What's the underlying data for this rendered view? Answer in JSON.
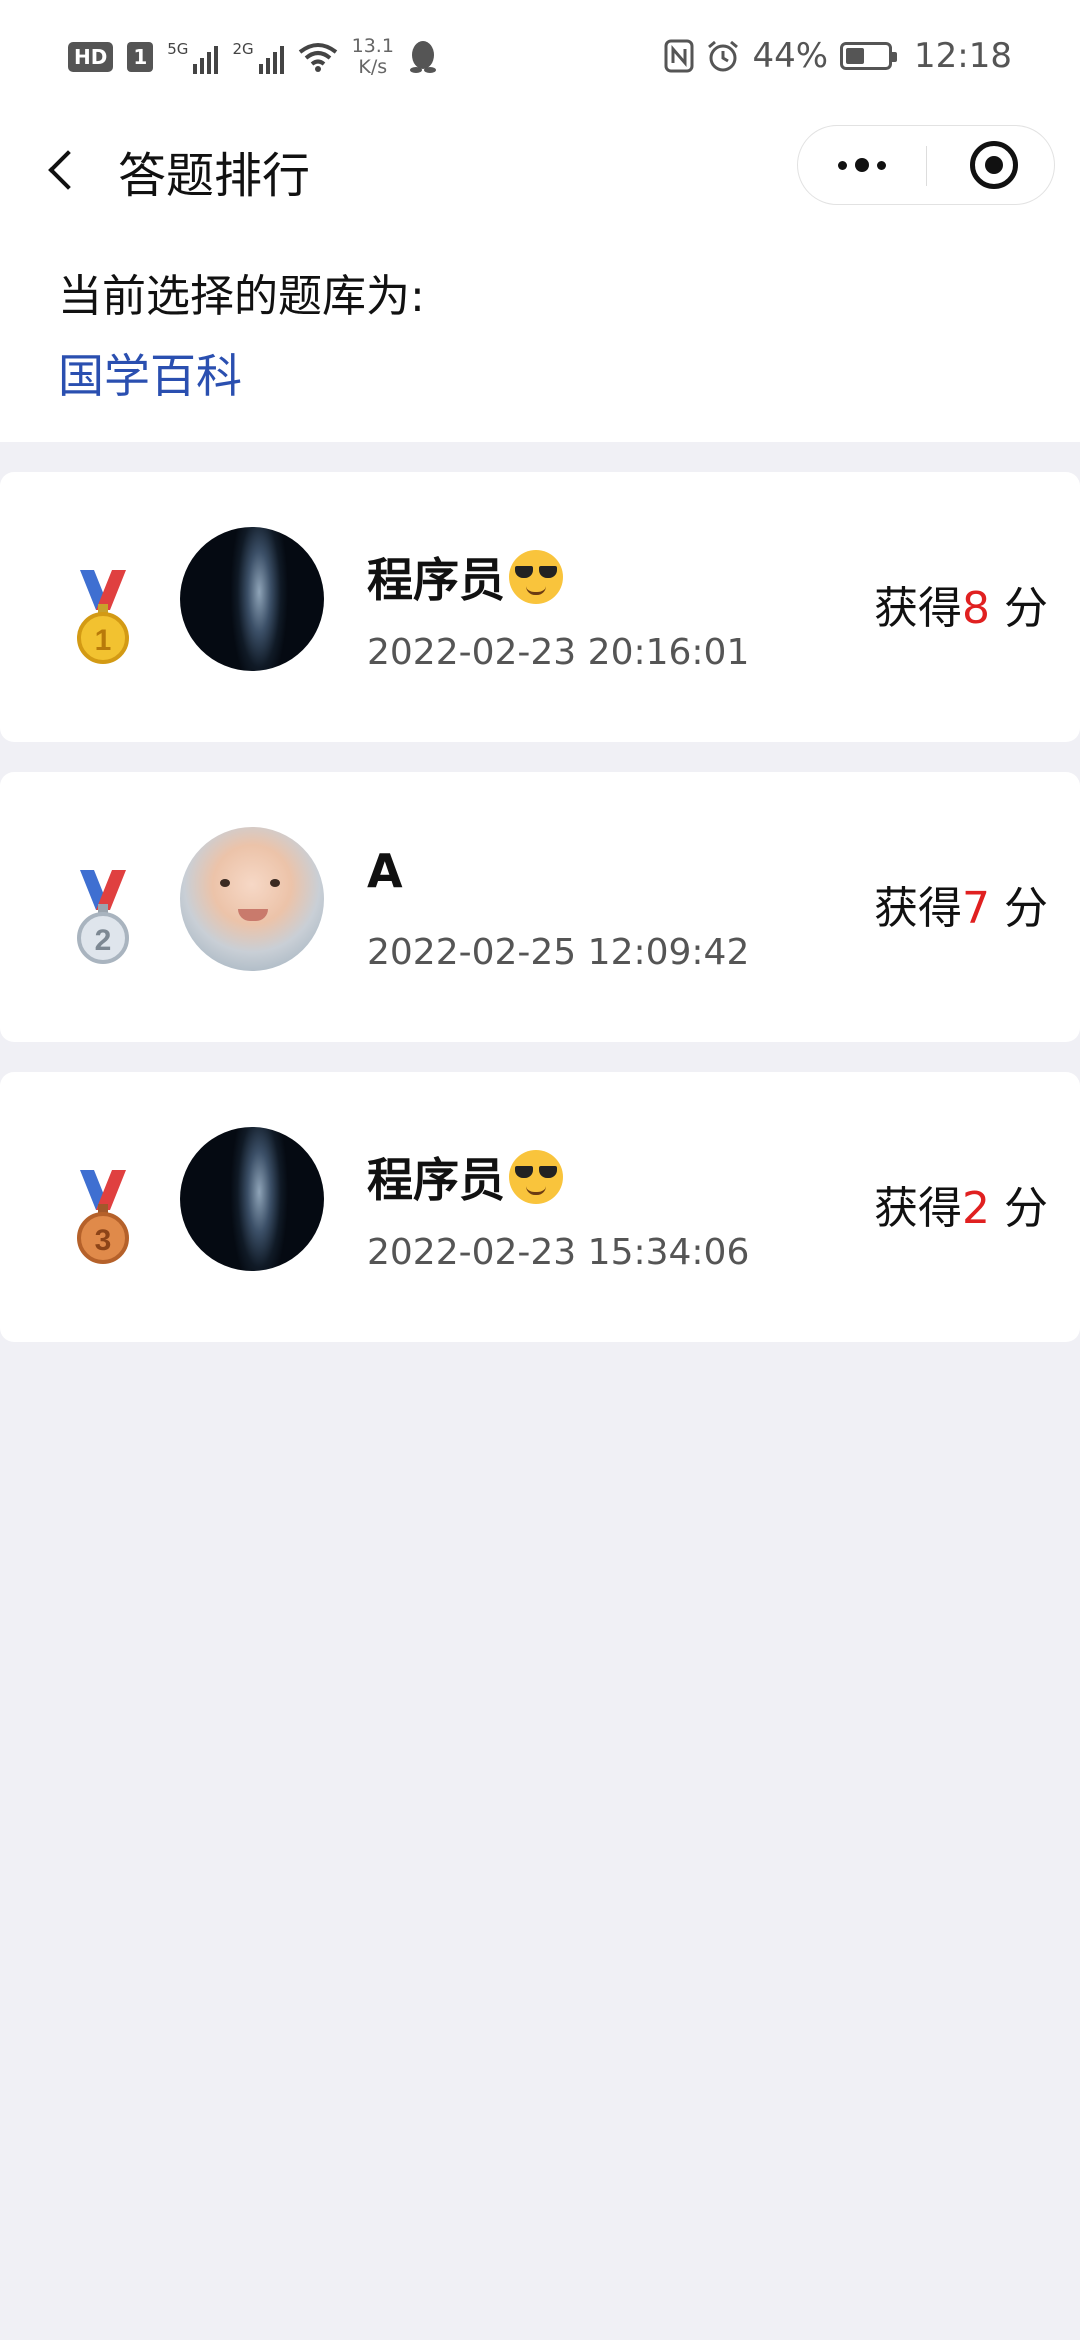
{
  "status_bar": {
    "hd_label": "HD",
    "sim_label": "1",
    "signal1_tag": "5G",
    "signal2_tag": "2G",
    "speed_value": "13.1",
    "speed_unit": "K/s",
    "battery_text": "44%",
    "battery_level": 0.44,
    "time": "12:18"
  },
  "nav": {
    "title": "答题排行"
  },
  "header": {
    "label": "当前选择的题库为:",
    "bank_name": "国学百科"
  },
  "colors": {
    "accent_blue": "#2a4fb0",
    "score_red": "#e02020",
    "page_bg": "#f0f0f5"
  },
  "rankings": [
    {
      "rank": "1",
      "medal": "gold-medal-icon",
      "avatar": "galaxy-avatar",
      "name": "程序员",
      "emoji": "sunglasses-emoji-icon",
      "time": "2022-02-23 20:16:01",
      "score_prefix": "获得",
      "score": "8",
      "score_unit": "分"
    },
    {
      "rank": "2",
      "medal": "silver-medal-icon",
      "avatar": "baby-photo-avatar",
      "name": "A",
      "emoji": "",
      "time": "2022-02-25 12:09:42",
      "score_prefix": "获得",
      "score": "7",
      "score_unit": "分"
    },
    {
      "rank": "3",
      "medal": "bronze-medal-icon",
      "avatar": "galaxy-avatar",
      "name": "程序员",
      "emoji": "sunglasses-emoji-icon",
      "time": "2022-02-23 15:34:06",
      "score_prefix": "获得",
      "score": "2",
      "score_unit": "分"
    }
  ]
}
